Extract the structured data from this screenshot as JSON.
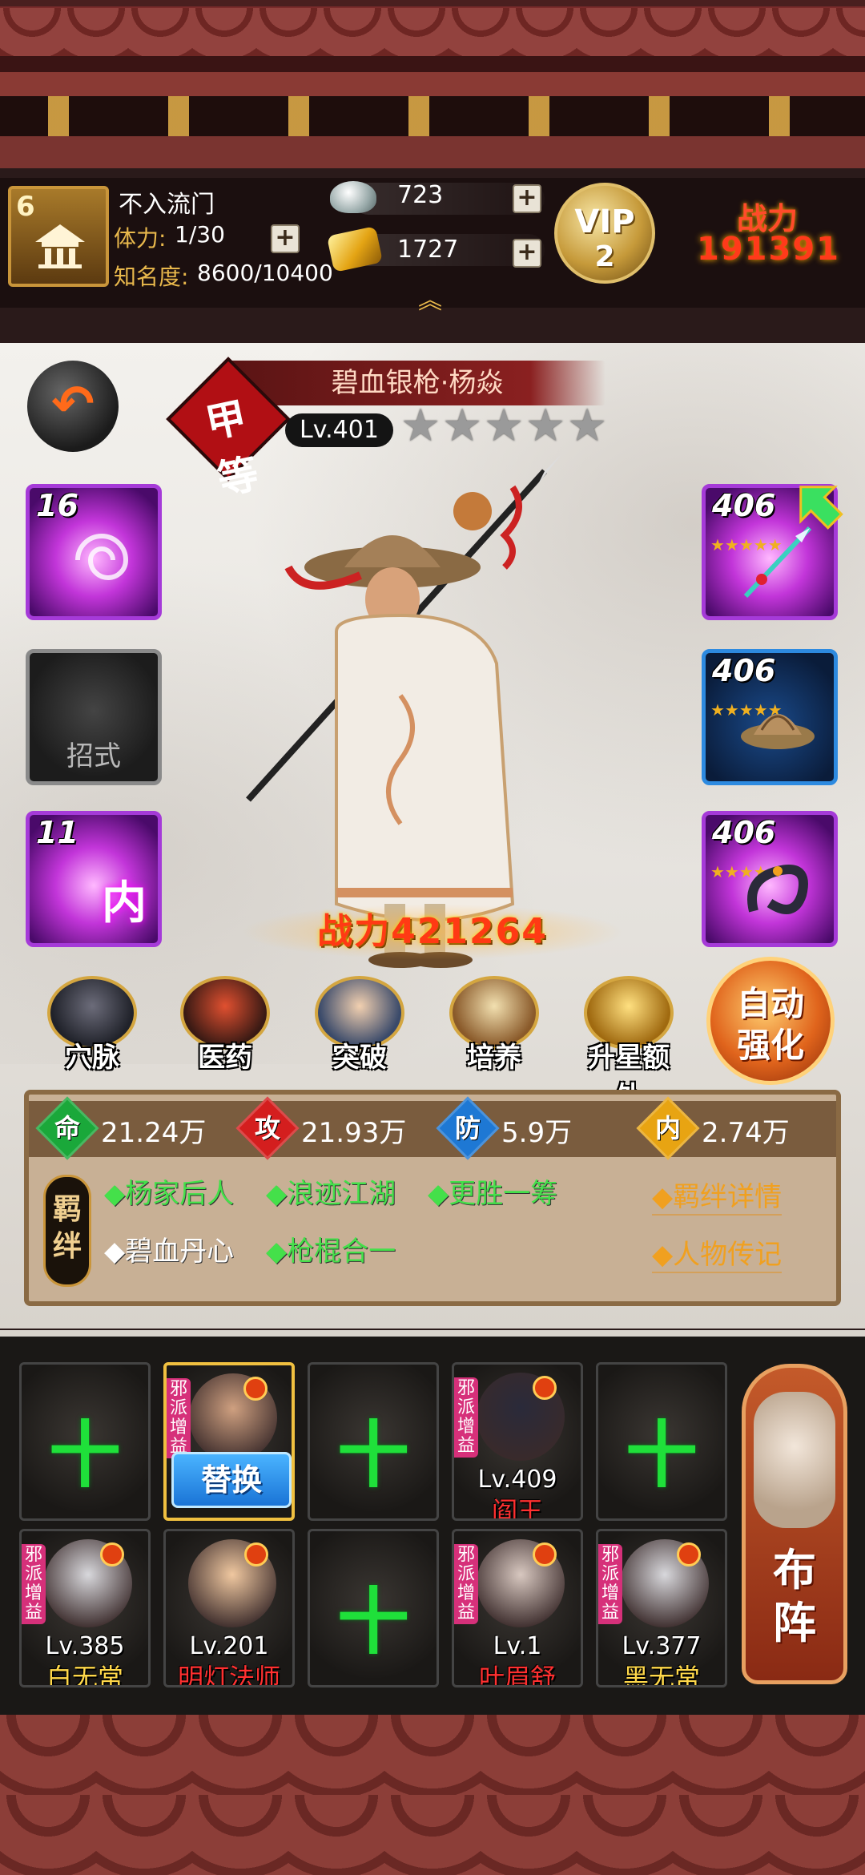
{
  "player": {
    "level": "6",
    "name": "不入流门",
    "stamina_label": "体力:",
    "stamina_value": "1/30",
    "fame_label": "知名度:",
    "fame_value": "8600/10400"
  },
  "resources": {
    "silver": "723",
    "gold": "1727",
    "add_label": "+"
  },
  "vip": {
    "text": "VIP",
    "level": "2"
  },
  "top_power": {
    "label": "战力",
    "value": "191391"
  },
  "hero": {
    "name": "碧血银枪·杨焱",
    "rank": "甲等",
    "level": "Lv.401",
    "stars_total": 5,
    "stars_filled": 0,
    "power": "战力421264"
  },
  "skills": [
    {
      "level": "16",
      "label": ""
    },
    {
      "level": "",
      "label": "招式"
    },
    {
      "level": "11",
      "label": "内"
    }
  ],
  "equipment": [
    {
      "level": "406",
      "icon": "spear-icon",
      "stars": "★★★★★"
    },
    {
      "level": "406",
      "icon": "straw-hat-icon",
      "stars": "★★★★★"
    },
    {
      "level": "406",
      "icon": "dragon-amulet-icon",
      "stars": "★★★★★"
    }
  ],
  "actions": [
    {
      "label": "穴脉",
      "icon": "meridian-icon"
    },
    {
      "label": "医药",
      "icon": "medicine-icon"
    },
    {
      "label": "突破",
      "icon": "breakthrough-icon"
    },
    {
      "label": "培养",
      "icon": "scroll-icon"
    },
    {
      "label": "升星额外",
      "icon": "star-up-icon"
    }
  ],
  "auto_enhance": {
    "line1": "自动",
    "line2": "强化"
  },
  "stats": [
    {
      "gem": "命",
      "value": "21.24万",
      "color": "#1aa83a"
    },
    {
      "gem": "攻",
      "value": "21.93万",
      "color": "#d41e1e"
    },
    {
      "gem": "防",
      "value": "5.9万",
      "color": "#1e78d4"
    },
    {
      "gem": "内",
      "value": "2.74万",
      "color": "#e8a412"
    }
  ],
  "bonds": {
    "badge_line1": "羁",
    "badge_line2": "绊",
    "items": [
      {
        "text": "◆杨家后人",
        "active": true
      },
      {
        "text": "◆浪迹江湖",
        "active": true
      },
      {
        "text": "◆更胜一筹",
        "active": true
      },
      {
        "text": "◆碧血丹心",
        "active": false
      },
      {
        "text": "◆枪棍合一",
        "active": true
      }
    ],
    "detail_link": "◆羁绊详情",
    "biography_link": "◆人物传记"
  },
  "lineup": {
    "evil_tag": "邪派增益",
    "swap_label": "替换",
    "formation_line1": "布",
    "formation_line2": "阵",
    "slots": [
      {
        "empty": true
      },
      {
        "empty": false,
        "selected": true,
        "level": "",
        "name": "",
        "evil": true
      },
      {
        "empty": true
      },
      {
        "empty": false,
        "level": "Lv.409",
        "name": "阎王",
        "name_color": "#ff3030",
        "evil": true
      },
      {
        "empty": true
      },
      {
        "empty": false,
        "level": "Lv.385",
        "name": "白无常",
        "name_color": "#ffd84a",
        "evil": true
      },
      {
        "empty": false,
        "level": "Lv.201",
        "name": "明灯法师",
        "name_color": "#ff3030",
        "evil": false
      },
      {
        "empty": true
      },
      {
        "empty": false,
        "level": "Lv.1",
        "name": "叶眉舒",
        "name_color": "#ff3030",
        "evil": true
      },
      {
        "empty": false,
        "level": "Lv.377",
        "name": "黑无常",
        "name_color": "#ffd84a",
        "evil": true
      }
    ]
  }
}
